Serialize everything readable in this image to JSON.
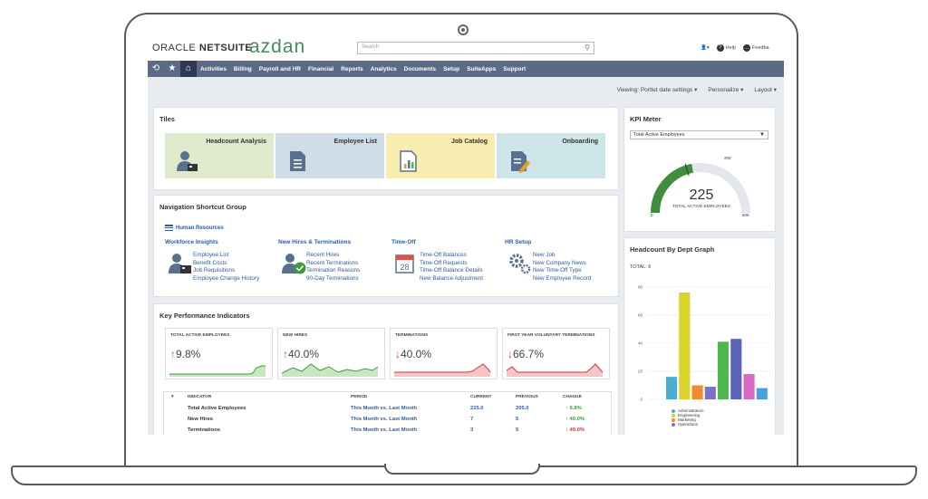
{
  "header": {
    "logo_oracle": "ORACLE",
    "logo_netsuite": "NETSUITE",
    "brand": "azdan",
    "search_placeholder": "Search",
    "help_label": "Help",
    "feedback_label": "Feedba"
  },
  "nav": {
    "items": [
      "Activities",
      "Billing",
      "Payroll and HR",
      "Financial",
      "Reports",
      "Analytics",
      "Documents",
      "Setup",
      "SuiteApps",
      "Support"
    ]
  },
  "viewbar": {
    "viewing": "Viewing: Portlet date settings ▾",
    "personalize": "Personalize ▾",
    "layout": "Layout ▾"
  },
  "tiles": {
    "title": "Tiles",
    "items": [
      {
        "label": "Headcount Analysis",
        "color": "#dfe9cc"
      },
      {
        "label": "Employee List",
        "color": "#cfdde8"
      },
      {
        "label": "Job Catalog",
        "color": "#f7edb0"
      },
      {
        "label": "Onboarding",
        "color": "#cde5e8"
      }
    ]
  },
  "nav_shortcut": {
    "title": "Navigation Shortcut Group",
    "hr_link": "Human Resources",
    "groups": [
      {
        "head": "Workforce Insights",
        "links": [
          "Employee List",
          "Benefit Costs",
          "Job Requisitions",
          "Employee Change History"
        ]
      },
      {
        "head": "New Hires & Terminations",
        "links": [
          "Recent Hires",
          "Recent Terminations",
          "Termination Reasons",
          "90-Day Terminations"
        ]
      },
      {
        "head": "Time-Off",
        "links": [
          "Time-Off Balances",
          "Time-Off Requests",
          "Time-Off Balance Details",
          "New Balance Adjustment"
        ]
      },
      {
        "head": "HR Setup",
        "links": [
          "New Job",
          "New Company News",
          "New Time-Off Type",
          "New Employee Record"
        ]
      }
    ]
  },
  "kpi": {
    "title": "Key Performance Indicators",
    "cards": [
      {
        "head": "TOTAL ACTIVE EMPLOYEES",
        "arrow": "↑",
        "value": "9.8%",
        "trend": "up"
      },
      {
        "head": "NEW HIRES",
        "arrow": "↑",
        "value": "40.0%",
        "trend": "up"
      },
      {
        "head": "TERMINATIONS",
        "arrow": "↓",
        "value": "40.0%",
        "trend": "down"
      },
      {
        "head": "FIRST YEAR VOLUNTARY TERMINATIONS",
        "arrow": "↓",
        "value": "66.7%",
        "trend": "down"
      }
    ],
    "table": {
      "headers": {
        "indicator": "INDICATOR",
        "period": "PERIOD",
        "current": "CURRENT",
        "previous": "PREVIOUS",
        "change": "CHANGE"
      },
      "rows": [
        {
          "indicator": "Total Active Employees",
          "period": "This Month vs. Last Month",
          "current": "225.0",
          "previous": "205.0",
          "change": "↑ 9.8%",
          "trend": "up"
        },
        {
          "indicator": "New Hires",
          "period": "This Month vs. Last Month",
          "current": "7",
          "previous": "5",
          "change": "↑ 40.0%",
          "trend": "up"
        },
        {
          "indicator": "Terminations",
          "period": "This Month vs. Last Month",
          "current": "3",
          "previous": "5",
          "change": "↓ 40.0%",
          "trend": "down"
        }
      ]
    }
  },
  "kpi_meter": {
    "title": "KPI Meter",
    "select": "Total Active Employees",
    "value": "225",
    "label": "TOTAL ACTIVE EMPLOYEES",
    "min": "0",
    "max": "508",
    "prev": "205",
    "colors": {
      "fill": "#3e8e3e",
      "track": "#e3e6ea"
    }
  },
  "headcount_graph": {
    "title": "Headcount By Dept Graph",
    "total": "TOTAL: 6"
  },
  "chart_data": {
    "type": "bar",
    "title": "Headcount By Dept Graph",
    "ylim": [
      0,
      85
    ],
    "yticks": [
      "0",
      "20",
      "40",
      "60",
      "80"
    ],
    "yticks_values": [
      0,
      20,
      40,
      60,
      80
    ],
    "values": [
      16,
      76,
      10,
      9,
      41,
      43,
      18,
      8
    ],
    "colors": [
      "#4aaed0",
      "#d8d42a",
      "#f08a2b",
      "#7a73c4",
      "#4eb84e",
      "#5a63b8",
      "#d86ac6",
      "#4aa0d8"
    ],
    "legend": [
      {
        "name": "Administration",
        "color": "#4aaed0"
      },
      {
        "name": "Engineering",
        "color": "#d8d42a"
      },
      {
        "name": "Marketing",
        "color": "#f08a2b"
      },
      {
        "name": "Operations",
        "color": "#7a73c4"
      }
    ]
  }
}
